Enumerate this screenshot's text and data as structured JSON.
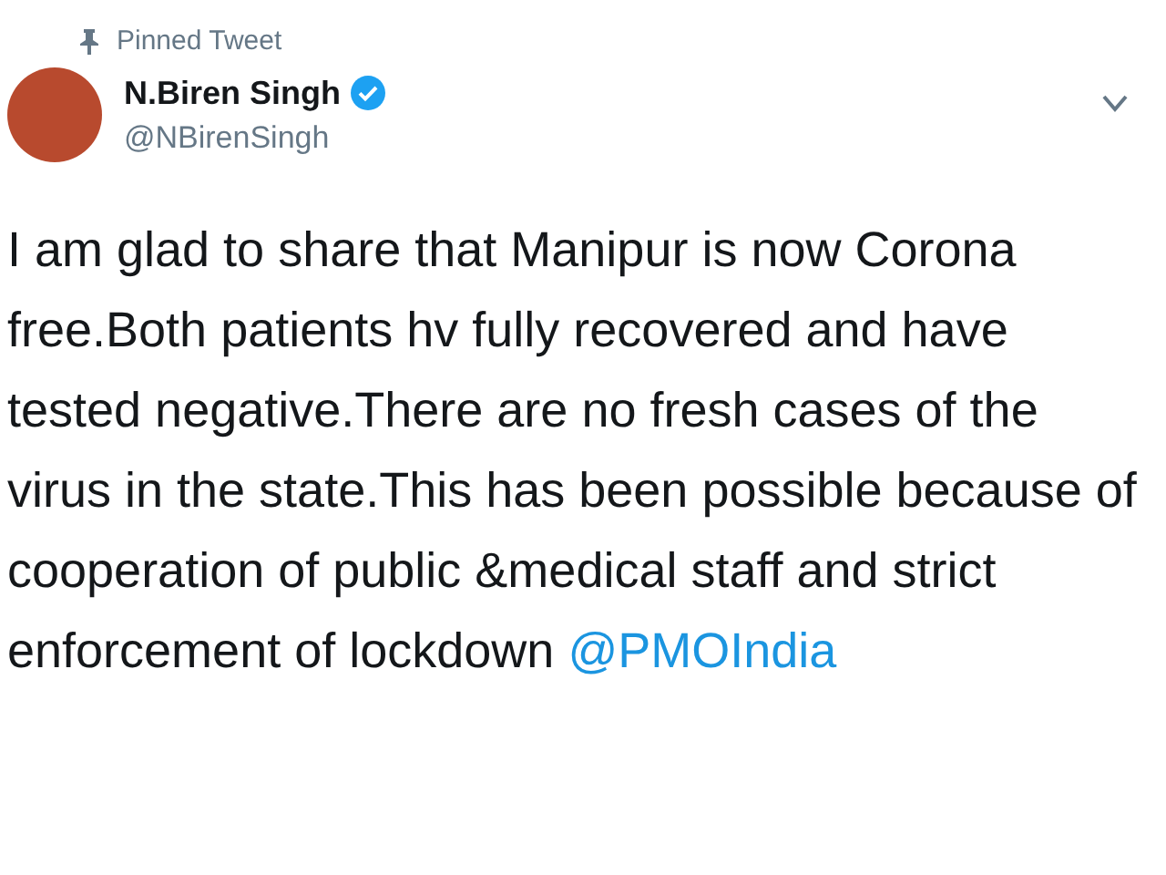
{
  "pinned": {
    "label": "Pinned Tweet"
  },
  "author": {
    "name": "N.Biren Singh",
    "handle": "@NBirenSingh",
    "verified": true
  },
  "tweet": {
    "text": "I am glad to share that Manipur is now Corona free.Both patients hv fully recovered and have tested negative.There are no fresh cases of the virus in the state.This has been possible because of cooperation of public &medical staff and strict enforcement of lockdown",
    "mention": "@PMOIndia"
  }
}
